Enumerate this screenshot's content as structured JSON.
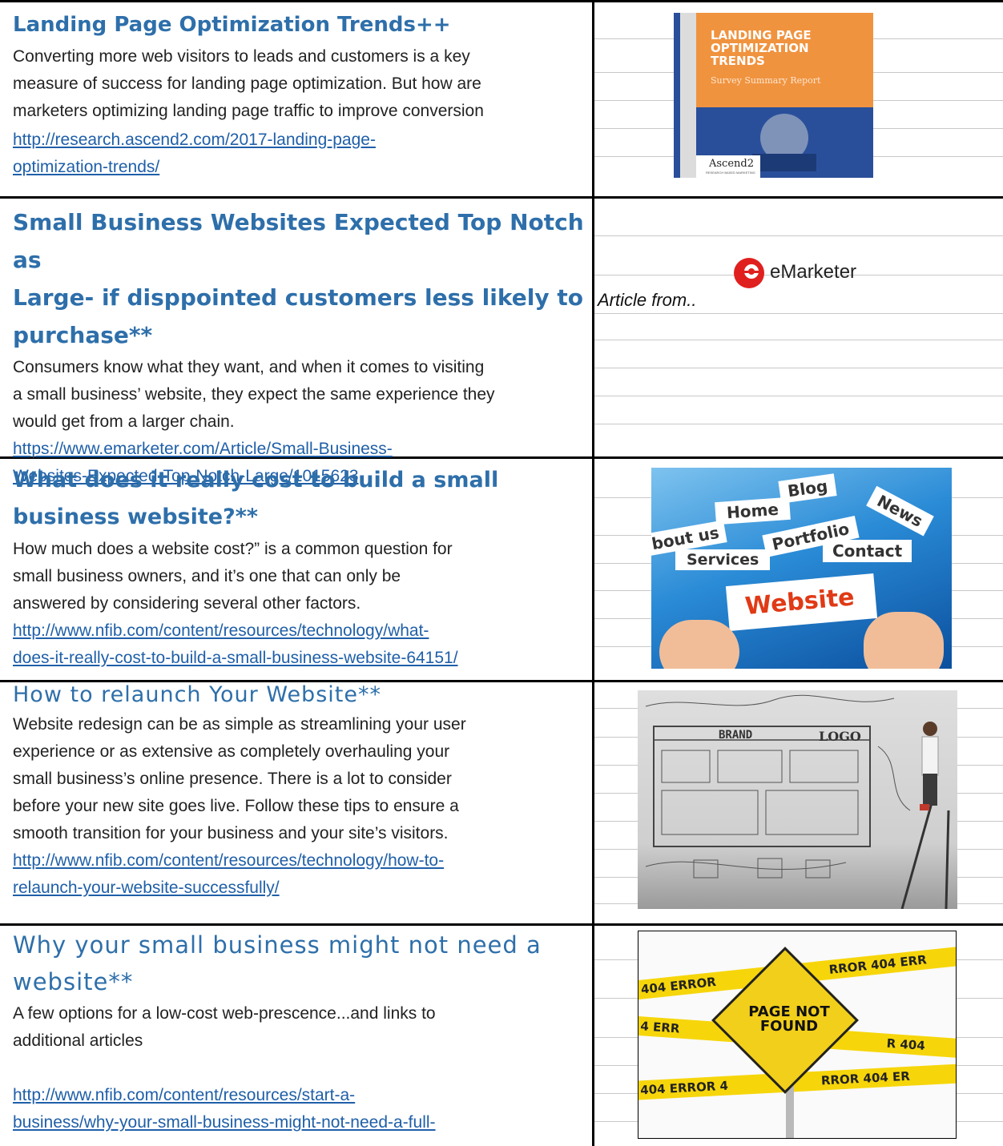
{
  "articles": [
    {
      "title": "Landing Page Optimization Trends++",
      "body": [
        "Converting more web visitors to leads and customers is a key",
        "measure of success for landing page optimization. But how are",
        "marketers optimizing landing page traffic to improve conversion"
      ],
      "link": [
        "http://research.ascend2.com/2017-landing-page-",
        "optimization-trends/"
      ],
      "image": {
        "heading": [
          "LANDING PAGE",
          "OPTIMIZATION",
          "TRENDS"
        ],
        "sub": "Survey Summary Report",
        "brand": "Ascend2",
        "brand_sub": "RESEARCH BASED MARKETING",
        "colors": {
          "orange": "#f0933f",
          "blue": "#2a4f9a"
        }
      }
    },
    {
      "title": [
        "Small Business Websites Expected Top Notch as",
        "Large- if disppointed customers less likely to",
        "purchase**"
      ],
      "body": [
        "Consumers know what they want, and when it comes to visiting",
        "a small business’ website, they expect the same experience they",
        "would get from a larger chain."
      ],
      "link": [
        "https://www.emarketer.com/Article/Small-Business-",
        "Websites-Expected-Top-Notch-Large/1015623"
      ],
      "logo_text": "eMarketer",
      "caption": "Article from.."
    },
    {
      "title": [
        "What does it really cost to build a small",
        "business website?**"
      ],
      "body": [
        "How much does a website cost?” is a common question for",
        "small business owners, and it’s one that can only be",
        "answered by considering several other factors."
      ],
      "link": [
        "http://www.nfib.com/content/resources/technology/what-",
        "does-it-really-cost-to-build-a-small-business-website-64151/"
      ],
      "image": {
        "words": [
          "Blog",
          "Home",
          "News",
          "bout us",
          "Portfolio",
          "Contact",
          "Services",
          "Website"
        ]
      }
    },
    {
      "title": "How to relaunch Your Website**",
      "body": [
        "Website redesign can be as simple as streamlining your user",
        "experience or as extensive as completely overhauling your",
        "small business’s online presence. There is a lot to consider",
        "before your new site goes live. Follow these tips to ensure a",
        "smooth transition for your business and your site’s visitors."
      ],
      "link": [
        "http://www.nfib.com/content/resources/technology/how-to-",
        "relaunch-your-website-successfully/"
      ],
      "image": {
        "words": [
          "BRAND",
          "LOGO"
        ]
      }
    },
    {
      "title": [
        "Why your small business might not need a",
        "website**"
      ],
      "body": [
        "A few options for a low-cost web-prescence...and links to",
        "additional articles"
      ],
      "link": [
        "http://www.nfib.com/content/resources/start-a-",
        "business/why-your-small-business-might-not-need-a-full-"
      ],
      "image": {
        "sign": [
          "PAGE NOT",
          "FOUND"
        ],
        "tape": [
          "404   ERROR",
          "RROR 404   ERR",
          "4   ERR",
          "R 404",
          "404   ERROR 4",
          "RROR 404   ER"
        ]
      }
    }
  ]
}
